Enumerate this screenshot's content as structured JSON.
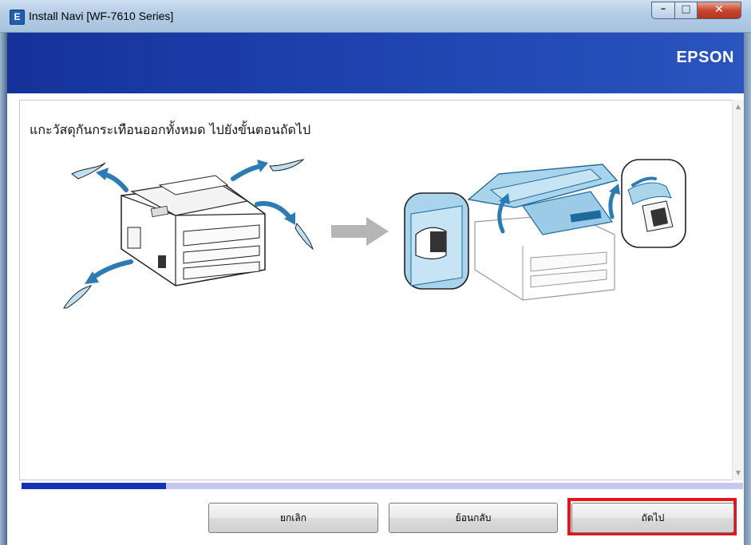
{
  "window": {
    "title": "Install Navi [WF-7610 Series]",
    "app_icon_letter": "E",
    "controls": {
      "minimize": "–",
      "maximize": "□",
      "close": "✕"
    }
  },
  "banner": {
    "brand": "EPSON"
  },
  "content": {
    "heading": "แกะวัสดุกันกระเทือนออกทั้งหมด ไปยังขั้นตอนถัดไป",
    "illustrations": [
      "printer-unpacking-icon",
      "arrow-right-icon",
      "printer-open-scanner-icon"
    ]
  },
  "progress": {
    "value": 0.2
  },
  "footer": {
    "cancel_label": "ยกเลิก",
    "back_label": "ย้อนกลับ",
    "next_label": "ถัดไป"
  },
  "colors": {
    "banner": "#1e43b0",
    "progress_fill": "#1731b4",
    "progress_track": "#c4c8ee",
    "highlight": "#e5131b",
    "illustration_blue": "#2d7bb5"
  }
}
